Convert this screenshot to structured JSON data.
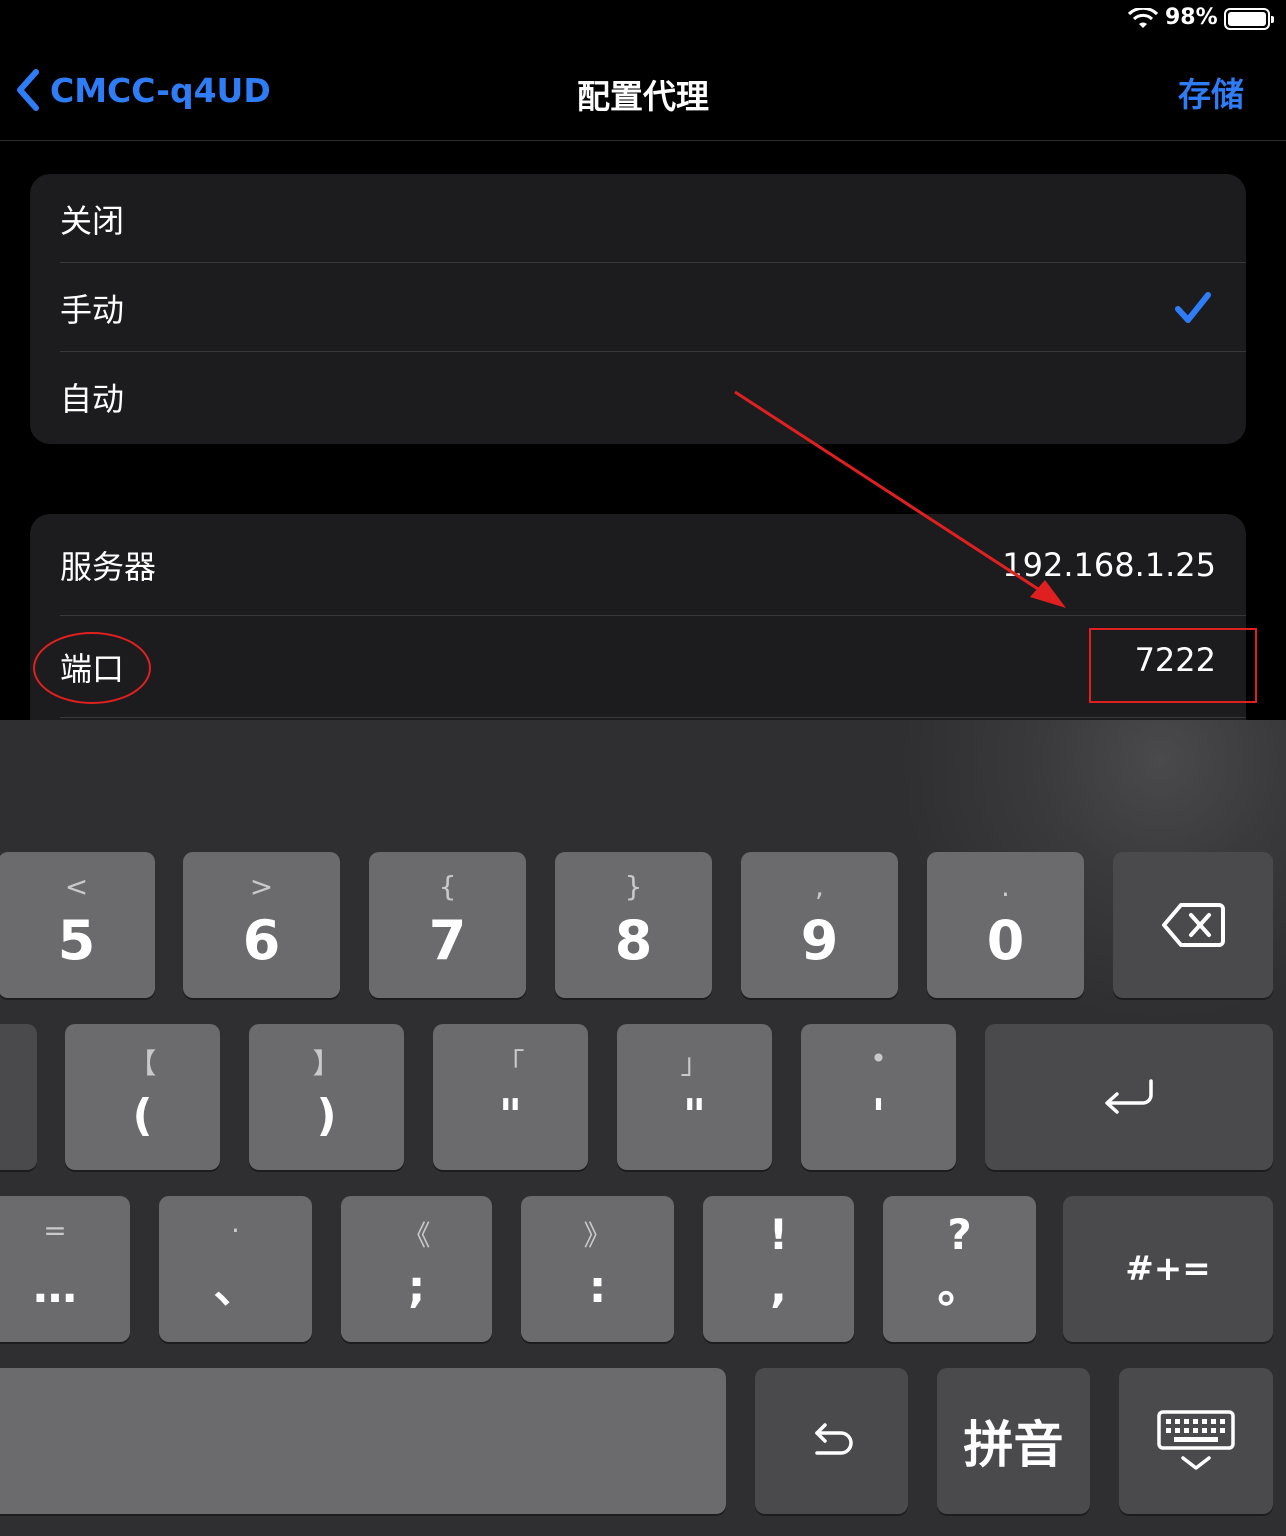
{
  "status": {
    "battery": "98%"
  },
  "nav": {
    "back_label": "CMCC-q4UD",
    "title": "配置代理",
    "save_label": "存储"
  },
  "proxy_modes": {
    "items": [
      {
        "label": "关闭",
        "selected": false
      },
      {
        "label": "手动",
        "selected": true
      },
      {
        "label": "自动",
        "selected": false
      }
    ]
  },
  "manual": {
    "server_label": "服务器",
    "server_value": "192.168.1.25",
    "port_label": "端口",
    "port_value": "7222"
  },
  "keyboard": {
    "row1": [
      {
        "alt": "<",
        "main": "5"
      },
      {
        "alt": ">",
        "main": "6"
      },
      {
        "alt": "{",
        "main": "7"
      },
      {
        "alt": "}",
        "main": "8"
      },
      {
        "alt": ",",
        "main": "9"
      },
      {
        "alt": ".",
        "main": "0"
      }
    ],
    "row2": [
      {
        "alt": "【",
        "main": "("
      },
      {
        "alt": "】",
        "main": ")"
      },
      {
        "alt": "「",
        "main": "\""
      },
      {
        "alt": "」",
        "main": "\""
      },
      {
        "alt": "•",
        "main": "'"
      }
    ],
    "row3": [
      {
        "alt": "=",
        "main": "…"
      },
      {
        "alt": "·",
        "main": "、"
      },
      {
        "alt": "《",
        "main": ";"
      },
      {
        "alt": "》",
        "main": ":"
      },
      {
        "alt": "!",
        "main": ","
      },
      {
        "alt": "?",
        "main": "。"
      }
    ],
    "more_symbols_label": "#+=",
    "pinyin_label": "拼音"
  },
  "colors": {
    "accent": "#2f7df6",
    "annotation": "#e02020"
  }
}
